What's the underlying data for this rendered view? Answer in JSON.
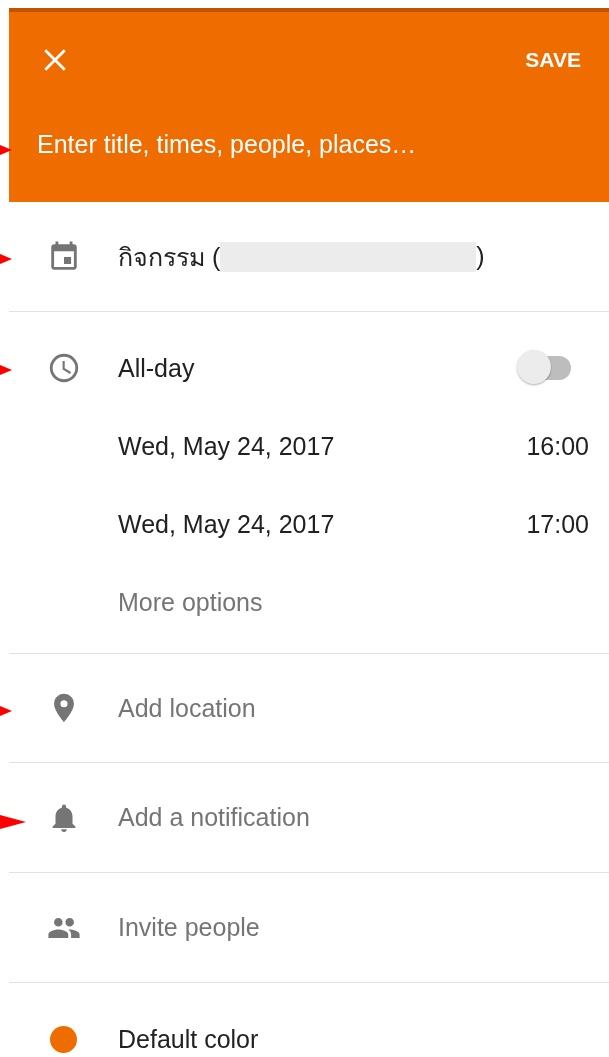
{
  "header": {
    "save_label": "SAVE",
    "title_placeholder": "Enter title, times, people, places…"
  },
  "calendar": {
    "label_start": "กิจกรรม (",
    "label_end": ")"
  },
  "all_day": {
    "label": "All-day",
    "on": false
  },
  "times": [
    {
      "date": "Wed, May 24, 2017",
      "time": "16:00"
    },
    {
      "date": "Wed, May 24, 2017",
      "time": "17:00"
    }
  ],
  "more_options": "More options",
  "location": {
    "placeholder": "Add location"
  },
  "notification": {
    "label": "Add a notification"
  },
  "invite": {
    "label": "Invite people"
  },
  "event_color": {
    "label": "Default color",
    "color": "#ef6c00"
  }
}
